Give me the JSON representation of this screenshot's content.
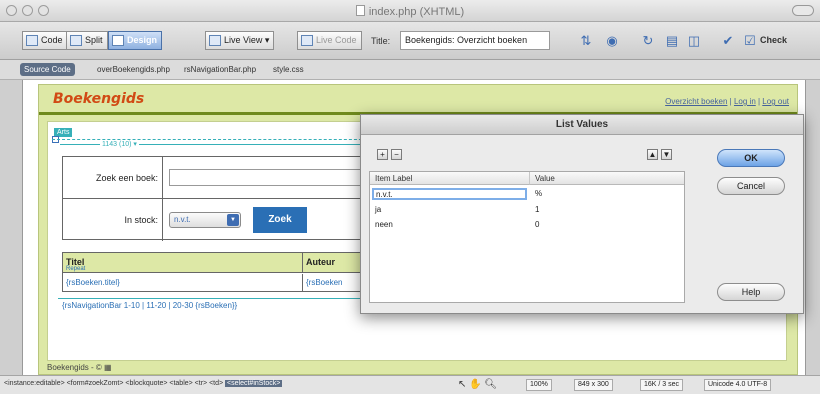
{
  "window": {
    "title": "index.php (XHTML)"
  },
  "toolbar": {
    "code": "Code",
    "split": "Split",
    "design": "Design",
    "live_view": "Live View",
    "live_code": "Live Code",
    "title_label": "Title:",
    "title_value": "Boekengids: Overzicht boeken",
    "check": "Check"
  },
  "filesbar": {
    "source_code": "Source Code",
    "files": [
      "overBoekengids.php",
      "rsNavigationBar.php",
      "style.css"
    ]
  },
  "page": {
    "logo": "Boekengids",
    "toplinks": [
      "Overzicht boeken",
      "Log in",
      "Log out"
    ],
    "region_tag": "Arts",
    "width_guide": "1143 (10) ▾",
    "form": {
      "label_search": "Zoek een boek:",
      "label_stock": "In stock:",
      "select_value": "n.v.t.",
      "button": "Zoek"
    },
    "results": {
      "col1": "Titel",
      "col1_sub": "Repeat",
      "col2": "Auteur",
      "cell1": "{rsBoeken.titel}",
      "cell2": "{rsBoeken"
    },
    "navbar": "{rsNavigationBar 1-10 | 11-20 | 20-30 {rsBoeken}}",
    "footer": "Boekengids - ©"
  },
  "statusbar": {
    "tags": "<instance:editable> <form#zoekZomt> <blockquote> <table> <tr> <td>",
    "current_tag": "<select#inStock>",
    "zoom": "100%",
    "dimensions": "849 x 300",
    "size": "16K / 3 sec",
    "encoding": "Unicode 4.0 UTF-8"
  },
  "dialog": {
    "title": "List Values",
    "add": "+",
    "remove": "−",
    "up": "▲",
    "down": "▼",
    "col_label": "Item Label",
    "col_value": "Value",
    "rows": [
      {
        "label": "n.v.t.",
        "value": "%"
      },
      {
        "label": "ja",
        "value": "1"
      },
      {
        "label": "neen",
        "value": "0"
      }
    ],
    "ok": "OK",
    "cancel": "Cancel",
    "help": "Help"
  }
}
